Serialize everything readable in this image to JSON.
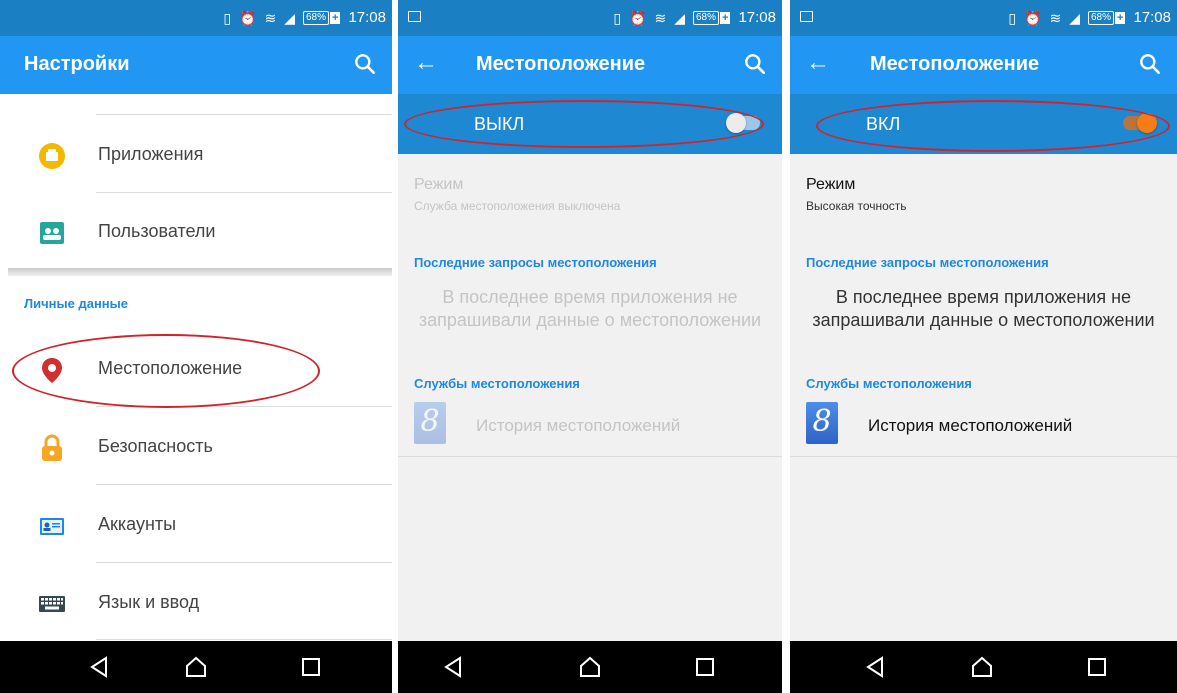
{
  "status": {
    "time": "17:08",
    "battery": "68%",
    "battery_plus": "+"
  },
  "screen1": {
    "title": "Настройки",
    "items": [
      {
        "label": "Приложения",
        "icon": "apps-icon"
      },
      {
        "label": "Пользователи",
        "icon": "users-icon"
      },
      {
        "label": "Местоположение",
        "icon": "location-pin-icon"
      },
      {
        "label": "Безопасность",
        "icon": "lock-icon"
      },
      {
        "label": "Аккаунты",
        "icon": "accounts-icon"
      },
      {
        "label": "Язык и ввод",
        "icon": "keyboard-icon"
      }
    ],
    "section_header": "Личные данные"
  },
  "screen2": {
    "title": "Местоположение",
    "switch_label": "ВЫКЛ",
    "switch_on": false,
    "mode_title": "Режим",
    "mode_sub": "Служба местоположения выключена",
    "recent_header": "Последние запросы местоположения",
    "recent_msg": "В последнее время приложения не запрашивали данные о местоположении",
    "services_header": "Службы местоположения",
    "history_label": "История местоположений",
    "google_glyph": "8"
  },
  "screen3": {
    "title": "Местоположение",
    "switch_label": "ВКЛ",
    "switch_on": true,
    "mode_title": "Режим",
    "mode_sub": "Высокая точность",
    "recent_header": "Последние запросы местоположения",
    "recent_msg": "В последнее время приложения не запрашивали данные о местоположении",
    "services_header": "Службы местоположения",
    "history_label": "История местоположений",
    "google_glyph": "8"
  },
  "colors": {
    "statusbar": "#1b7fc3",
    "appbar": "#2196f3",
    "switchbar": "#1e88d2",
    "accent_text": "#1e88e5",
    "switch_on_knob": "#f57c16",
    "highlight_ellipse": "#d2232a"
  }
}
